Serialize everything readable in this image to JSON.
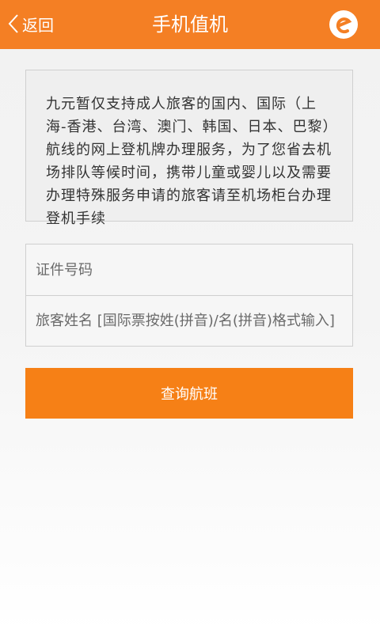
{
  "header": {
    "back_label": "返回",
    "title": "手机值机",
    "logo_icon": "brand-logo-icon"
  },
  "notice": {
    "text": "九元暂仅支持成人旅客的国内、国际（上海-香港、台湾、澳门、韩国、日本、巴黎）航线的网上登机牌办理服务，为了您省去机场排队等候时间，携带儿童或婴儿以及需要办理特殊服务申请的旅客请至机场柜台办理登机手续"
  },
  "form": {
    "id_placeholder": "证件号码",
    "name_placeholder": "旅客姓名 [国际票按姓(拼音)/名(拼音)格式输入]",
    "id_value": "",
    "name_value": ""
  },
  "actions": {
    "search_label": "查询航班"
  },
  "colors": {
    "brand": "#f47f24",
    "button": "#f68016"
  }
}
